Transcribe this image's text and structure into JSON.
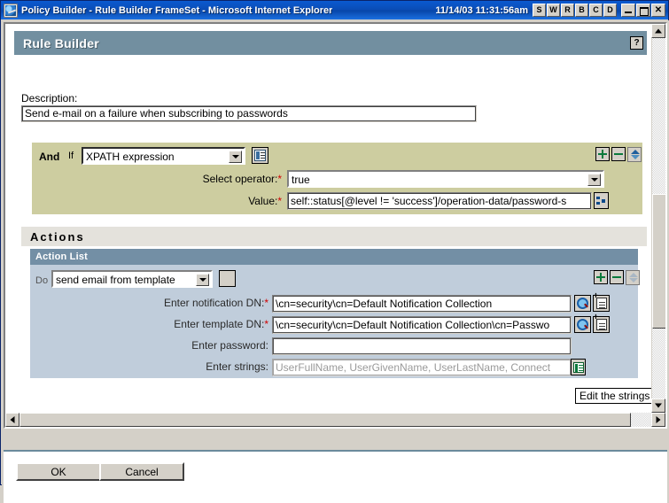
{
  "window": {
    "title": "Policy Builder - Rule Builder FrameSet - Microsoft Internet Explorer",
    "clock": "11/14/03 11:31:56am",
    "toolbar_letters": [
      "S",
      "W",
      "R",
      "B",
      "C",
      "D"
    ],
    "minimize": "_",
    "maximize": "□",
    "close": "✕"
  },
  "header": {
    "title": "Rule Builder",
    "help_label": "?"
  },
  "description": {
    "label": "Description:",
    "value": "Send e-mail on a failure when subscribing to passwords",
    "placeholder": ""
  },
  "condition": {
    "and_label": "And",
    "if_label": "If",
    "type_value": "XPATH expression",
    "operator_label": "Select operator:",
    "operator_required": "*",
    "operator_value": "true",
    "value_label": "Value:",
    "value_required": "*",
    "value_value": "self::status[@level != 'success']/operation-data/password-s"
  },
  "actions": {
    "section_label": "Actions",
    "list_label": "Action List",
    "do_label": "Do",
    "do_value": "send email from template",
    "fields": [
      {
        "label": "Enter notification DN:",
        "required": "*",
        "value": "\\cn=security\\cn=Default Notification Collection",
        "muted": false
      },
      {
        "label": "Enter template DN:",
        "required": "*",
        "value": "\\cn=security\\cn=Default Notification Collection\\cn=Passwo",
        "muted": false
      },
      {
        "label": "Enter password:",
        "required": "",
        "value": "",
        "muted": false
      },
      {
        "label": "Enter strings:",
        "required": "",
        "value": "UserFullName, UserGivenName, UserLastName, Connect",
        "muted": true
      }
    ],
    "edit_strings_label": "Edit the strings"
  },
  "footer": {
    "ok_label": "OK",
    "cancel_label": "Cancel"
  },
  "colors": {
    "titlebar": "#0a50bb",
    "header_band": "#728fa0",
    "condition_bg": "#cdcda0",
    "action_bg": "#c0cddb",
    "actionlist_band": "#738fa5",
    "actions_band": "#e4e2dc",
    "required_star": "#d00000",
    "button_face": "#d4d0c8"
  }
}
